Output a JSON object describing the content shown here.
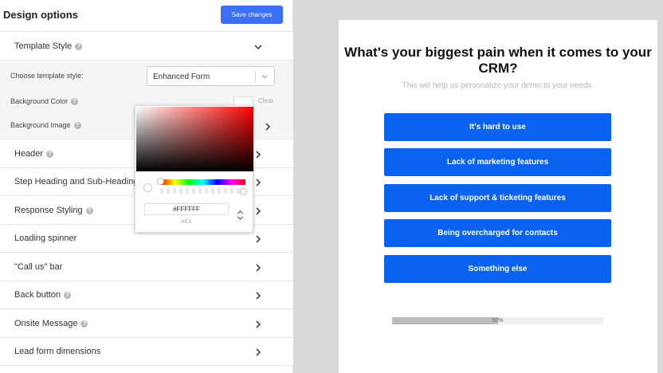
{
  "panel": {
    "title": "Design options",
    "save_label": "Save changes"
  },
  "template_style": {
    "label": "Template Style",
    "choose_label": "Choose template style:",
    "selected": "Enhanced Form",
    "bg_color_label": "Background Color",
    "clear_label": "Clear",
    "bg_image_label": "Background Image"
  },
  "sections": [
    {
      "label": "Header"
    },
    {
      "label": "Step Heading and Sub-Heading"
    },
    {
      "label": "Response Styling"
    },
    {
      "label": "Loading spinner"
    },
    {
      "label": "\"Call us\" bar"
    },
    {
      "label": "Back button"
    },
    {
      "label": "Onsite Message"
    },
    {
      "label": "Lead form dimensions"
    }
  ],
  "color_picker": {
    "hex_value": "#FFFFFF",
    "hex_label": "HEX",
    "hue_color": "#ff0000"
  },
  "preview": {
    "question": "What's your biggest pain when it comes to your CRM?",
    "subtitle": "This will help us personalize your demo to your needs.",
    "options": [
      "It's hard to use",
      "Lack of marketing features",
      "Lack of support & ticketing features",
      "Being overcharged for contacts",
      "Something else"
    ],
    "progress": {
      "percent": 50,
      "label": "50%"
    }
  },
  "colors": {
    "accent": "#3b6ff5",
    "option_bg": "#0a63f0"
  }
}
